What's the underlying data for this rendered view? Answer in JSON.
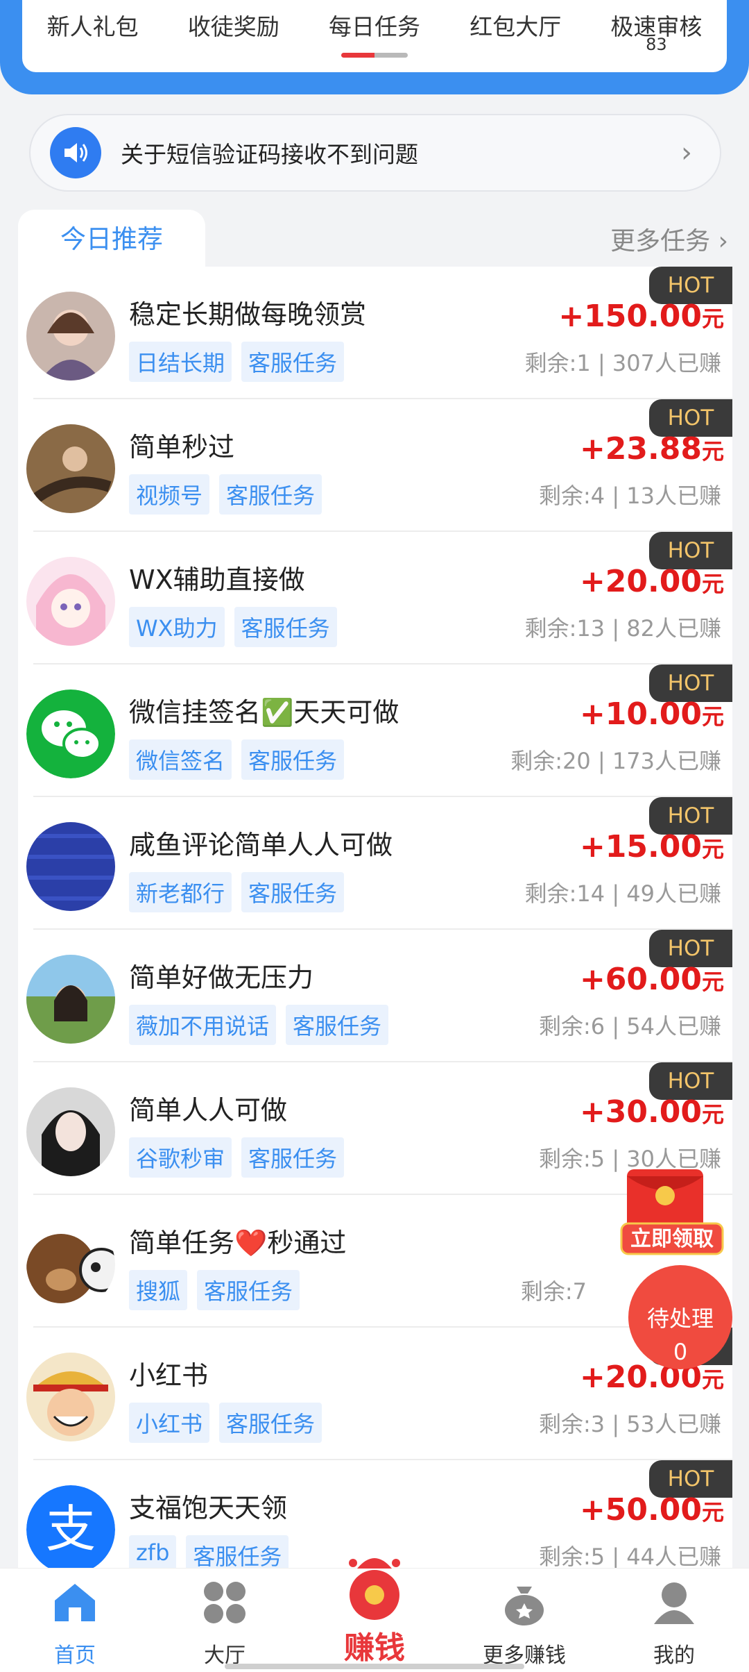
{
  "top_tabs": [
    {
      "label": "新人礼包"
    },
    {
      "label": "收徒奖励"
    },
    {
      "label": "每日任务"
    },
    {
      "label": "红包大厅"
    },
    {
      "label": "极速审核",
      "count": "83"
    }
  ],
  "notice": {
    "text": "关于短信验证码接收不到问题",
    "icon": "speaker-icon"
  },
  "section": {
    "tab_label": "今日推荐",
    "more_label": "更多任务 ›"
  },
  "hot_label": "HOT",
  "currency": "元",
  "tasks": [
    {
      "title": "稳定长期做每晚领赏",
      "tags": [
        "日结长期",
        "客服任务"
      ],
      "price": "+150.00",
      "meta": "剩余:1 | 307人已赚"
    },
    {
      "title": "简单秒过",
      "tags": [
        "视频号",
        "客服任务"
      ],
      "price": "+23.88",
      "meta": "剩余:4 | 13人已赚"
    },
    {
      "title": "WX辅助直接做",
      "tags": [
        "WX助力",
        "客服任务"
      ],
      "price": "+20.00",
      "meta": "剩余:13 | 82人已赚"
    },
    {
      "title": "微信挂签名✅天天可做",
      "tags": [
        "微信签名",
        "客服任务"
      ],
      "price": "+10.00",
      "meta": "剩余:20 | 173人已赚"
    },
    {
      "title": "咸鱼评论简单人人可做",
      "tags": [
        "新老都行",
        "客服任务"
      ],
      "price": "+15.00",
      "meta": "剩余:14 | 49人已赚"
    },
    {
      "title": "简单好做无压力",
      "tags": [
        "薇加不用说话",
        "客服任务"
      ],
      "price": "+60.00",
      "meta": "剩余:6 | 54人已赚"
    },
    {
      "title": "简单人人可做",
      "tags": [
        "谷歌秒审",
        "客服任务"
      ],
      "price": "+30.00",
      "meta": "剩余:5 | 30人已赚"
    },
    {
      "title": "简单任务❤️秒通过",
      "tags": [
        "搜狐",
        "客服任务"
      ],
      "price": "",
      "meta": "剩余:7"
    },
    {
      "title": "小红书",
      "tags": [
        "小红书",
        "客服任务"
      ],
      "price": "+20.00",
      "meta": "剩余:3 | 53人已赚"
    },
    {
      "title": "支福饱天天领",
      "tags": [
        "zfb",
        "客服任务"
      ],
      "price": "+50.00",
      "meta": "剩余:5 | 44人已赚"
    }
  ],
  "floating": {
    "redpacket_label": "立即领取",
    "pending_label": "待处理",
    "pending_count": "0"
  },
  "bottom_nav": [
    {
      "label": "首页",
      "icon": "home-icon"
    },
    {
      "label": "大厅",
      "icon": "grid-icon"
    },
    {
      "label": "赚钱",
      "icon": "money-bag-icon"
    },
    {
      "label": "更多赚钱",
      "icon": "money-sack-icon"
    },
    {
      "label": "我的",
      "icon": "user-icon"
    }
  ],
  "colors": {
    "accent": "#3b8ff0",
    "price": "#e21b1b",
    "hot_bg": "#3a3a3a",
    "hot_text": "#f2c46a"
  }
}
